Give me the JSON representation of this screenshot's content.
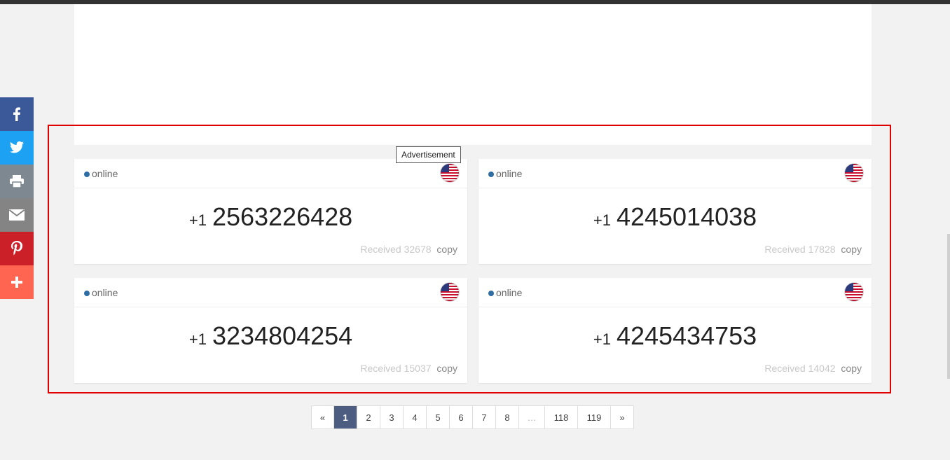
{
  "ad_label": "Advertisement",
  "social": [
    {
      "name": "facebook",
      "icon": "facebook-icon",
      "color": "#3b5998"
    },
    {
      "name": "twitter",
      "icon": "twitter-icon",
      "color": "#1da1f2"
    },
    {
      "name": "print",
      "icon": "print-icon",
      "color": "#7d8890"
    },
    {
      "name": "email",
      "icon": "email-icon",
      "color": "#848484"
    },
    {
      "name": "pinterest",
      "icon": "pinterest-icon",
      "color": "#cb2027"
    },
    {
      "name": "more",
      "icon": "plus-icon",
      "color": "#ff6550"
    }
  ],
  "numbers": [
    {
      "status": "online",
      "flag": "us-flag-icon",
      "country_code": "+1",
      "phone": "2563226428",
      "received_label": "Received",
      "received_count": "32678",
      "copy_label": "copy"
    },
    {
      "status": "online",
      "flag": "us-flag-icon",
      "country_code": "+1",
      "phone": "4245014038",
      "received_label": "Received",
      "received_count": "17828",
      "copy_label": "copy"
    },
    {
      "status": "online",
      "flag": "us-flag-icon",
      "country_code": "+1",
      "phone": "3234804254",
      "received_label": "Received",
      "received_count": "15037",
      "copy_label": "copy"
    },
    {
      "status": "online",
      "flag": "us-flag-icon",
      "country_code": "+1",
      "phone": "4245434753",
      "received_label": "Received",
      "received_count": "14042",
      "copy_label": "copy"
    }
  ],
  "pagination": {
    "prev": "«",
    "pages": [
      "1",
      "2",
      "3",
      "4",
      "5",
      "6",
      "7",
      "8",
      "…",
      "118",
      "119"
    ],
    "next": "»",
    "current": "1"
  },
  "colors": {
    "status_dot": "#2e6da4",
    "highlight": "#e00000",
    "active_page": "#4d5d82"
  }
}
